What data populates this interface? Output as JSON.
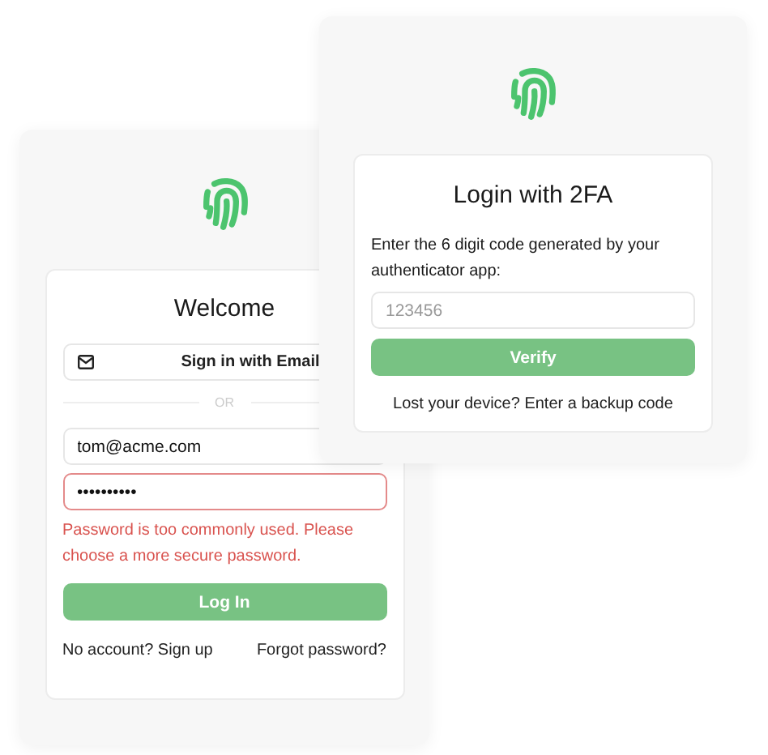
{
  "login_window": {
    "title": "Welcome",
    "email_button": "Sign in with Email",
    "divider": "OR",
    "email": {
      "value": "tom@acme.com",
      "error": false
    },
    "password": {
      "value": "••••••••••",
      "error": true
    },
    "error_message": "Password is too commonly used. Please choose a more secure password.",
    "submit": "Log In",
    "signup_link": "No account? Sign up",
    "forgot_link": "Forgot password?"
  },
  "twofa_window": {
    "title": "Login with 2FA",
    "instructions": "Enter the 6 digit code generated by your authenticator app:",
    "code": {
      "placeholder": "123456"
    },
    "submit": "Verify",
    "backup_link": "Lost your device? Enter a backup code"
  }
}
